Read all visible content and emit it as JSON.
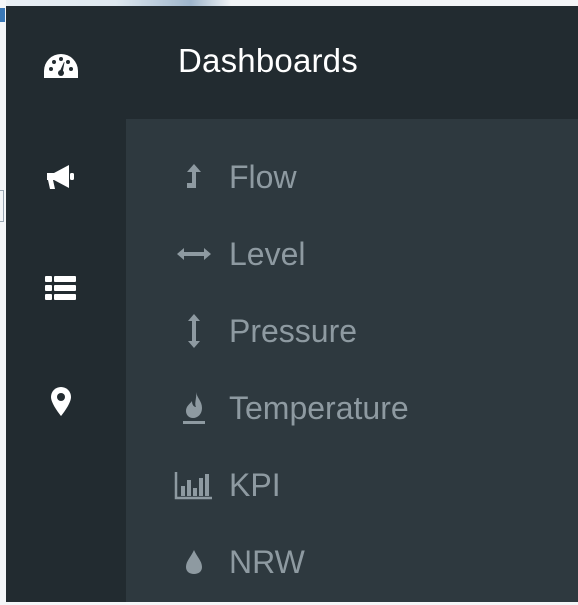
{
  "header": {
    "title": "Dashboards"
  },
  "icon_rail": [
    {
      "name": "dashboard-icon"
    },
    {
      "name": "megaphone-icon"
    },
    {
      "name": "list-icon"
    },
    {
      "name": "map-marker-icon"
    }
  ],
  "submenu": [
    {
      "label": "Flow",
      "icon": "flow-arrow-up-icon"
    },
    {
      "label": "Level",
      "icon": "horizontal-arrows-icon"
    },
    {
      "label": "Pressure",
      "icon": "vertical-arrows-icon"
    },
    {
      "label": "Temperature",
      "icon": "flame-icon"
    },
    {
      "label": "KPI",
      "icon": "bar-chart-icon"
    },
    {
      "label": "NRW",
      "icon": "water-drop-icon"
    }
  ],
  "colors": {
    "rail_bg": "#222b30",
    "panel_bg": "#2e393f",
    "header_text": "#ffffff",
    "item_text": "#8e9aa1",
    "rail_icon": "#ffffff"
  }
}
